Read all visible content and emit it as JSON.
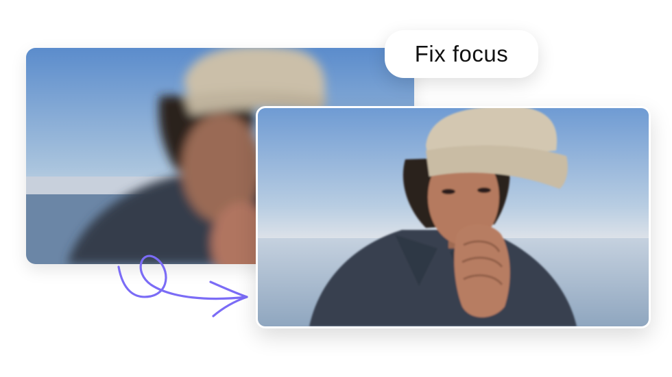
{
  "label": {
    "text": "Fix focus"
  },
  "images": {
    "before": {
      "name": "blurry-portrait-photo",
      "state": "out of focus"
    },
    "after": {
      "name": "sharp-portrait-photo",
      "state": "in focus"
    }
  },
  "colors": {
    "accent_arrow": "#7b6cf6",
    "sky_top": "#5f8fcf",
    "sky_bottom": "#dfe7ee",
    "sea": "#6f8aa8",
    "cap": "#cfc2ac",
    "jacket": "#3a4454",
    "skin": "#b77d62",
    "hair": "#2a211d"
  }
}
